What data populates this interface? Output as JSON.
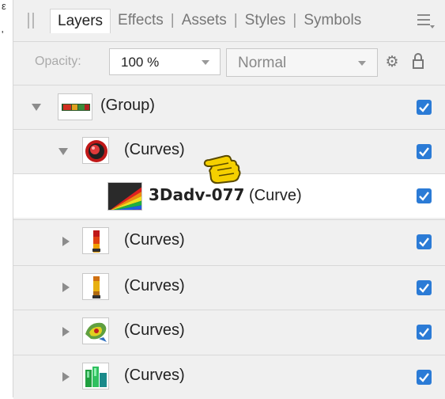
{
  "edge_marks": [
    "ε",
    "'"
  ],
  "tabs": [
    "Layers",
    "Effects",
    "Assets",
    "Styles",
    "Symbols"
  ],
  "active_tab": "Layers",
  "tab_separator": "|",
  "options": {
    "opacity_label": "Opacity:",
    "opacity_value": "100 %",
    "blend_mode": "Normal"
  },
  "layers": [
    {
      "name": "(Group)",
      "expanded": true,
      "level": 0,
      "visible": true,
      "thumb": "group-thumb"
    },
    {
      "name": "(Curves)",
      "expanded": true,
      "level": 1,
      "visible": true,
      "thumb": "red-orb-thumb"
    },
    {
      "name_bold": "3Dadv-077",
      "name_suffix": "(Curve)",
      "level": 2,
      "visible": true,
      "selected": true,
      "thumb": "rainbow-thumb"
    },
    {
      "name": "(Curves)",
      "expanded": false,
      "level": 1,
      "visible": true,
      "thumb": "orange-bar-thumb"
    },
    {
      "name": "(Curves)",
      "expanded": false,
      "level": 1,
      "visible": true,
      "thumb": "yellow-bar-thumb"
    },
    {
      "name": "(Curves)",
      "expanded": false,
      "level": 1,
      "visible": true,
      "thumb": "green-swirl-thumb"
    },
    {
      "name": "(Curves)",
      "expanded": false,
      "level": 1,
      "visible": true,
      "thumb": "green-blocks-thumb"
    }
  ],
  "colors": {
    "panel_bg": "#f0f0f0",
    "checkbox": "#2b7bd6",
    "cursor": "#f5d000"
  },
  "cursor_icon": "pointing-hand-cursor"
}
